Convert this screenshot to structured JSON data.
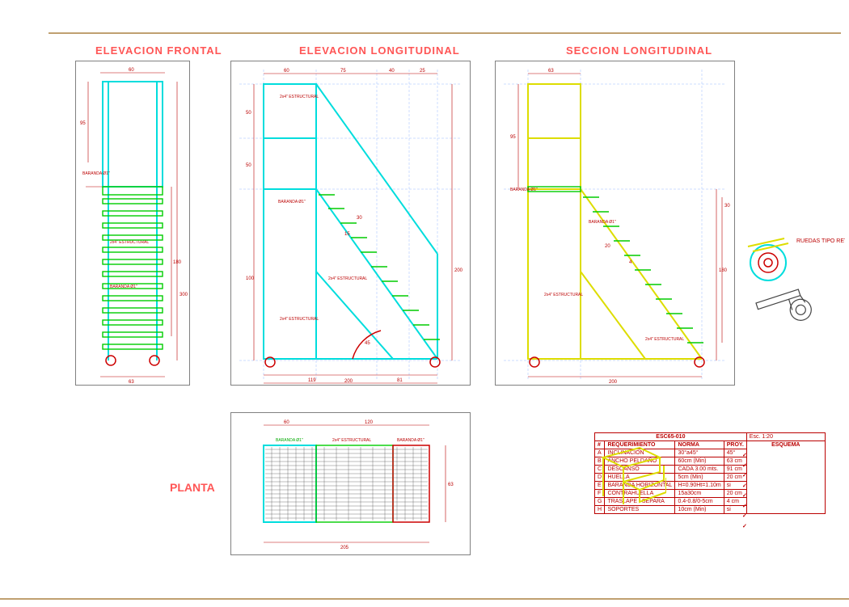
{
  "titles": {
    "frontal": "ELEVACION FRONTAL",
    "long": "ELEVACION LONGITUDINAL",
    "seccion": "SECCION LONGITUDINAL",
    "planta": "PLANTA"
  },
  "labels": {
    "estructural": "2x4\" ESTRUCTURAL",
    "baranda": "BARANDA Ø1\"",
    "angulo": "45",
    "ruedas": "RUEDAS TIPO RETRÁCTILES DE SEGURIDAD"
  },
  "dims_frontal": {
    "w_top": "60",
    "h_total": "300",
    "h_mid": "180",
    "w_bot": "63",
    "h1": "95"
  },
  "dims_long": {
    "seg_top": [
      "60",
      "75",
      "40",
      "25"
    ],
    "bot_total": "200",
    "bot_a": "119",
    "bot_b": "81",
    "h_side": "200",
    "h1": "100",
    "h2": "50",
    "h3": "50",
    "step": "30",
    "step_l": "15"
  },
  "dims_sec": {
    "w_top": "63",
    "h_side": "95",
    "h2": "180",
    "step_h": "30",
    "step_w": "20",
    "step_g": "4",
    "bot_total": "200"
  },
  "dims_plan": {
    "w1": "60",
    "w2": "120",
    "h": "63",
    "total": "205"
  },
  "table": {
    "code": "ESC65-010",
    "scale": "Esc. 1:20",
    "headers": [
      "#",
      "REQUERIMIENTO",
      "NORMA",
      "PROY.",
      "ESQUEMA"
    ],
    "rows": [
      [
        "A",
        "INCLINACION",
        "30°a45°",
        "45°",
        "✓"
      ],
      [
        "B",
        "ANCHO PELDAÑO",
        "60cm (Min)",
        "63 cm",
        "✓"
      ],
      [
        "C",
        "DESCANSO",
        "CADA 3.00 mts.",
        "91 cm",
        "✓"
      ],
      [
        "D",
        "HUELLA",
        "5cm (Min)",
        "20 cm",
        "✓"
      ],
      [
        "E",
        "BARANDA HORIZONTAL",
        "H=0.90Ht=1.10m",
        "si",
        "✓"
      ],
      [
        "F",
        "CONTRAHUELLA",
        "15a30cm",
        "20 cm",
        "✓"
      ],
      [
        "G",
        "TRASLAPE / SEPARA",
        "0.4-0.8/0-5cm",
        "4 cm",
        "✓"
      ],
      [
        "H",
        "SOPORTES",
        "10cm (Min)",
        "si",
        "✓"
      ]
    ]
  }
}
